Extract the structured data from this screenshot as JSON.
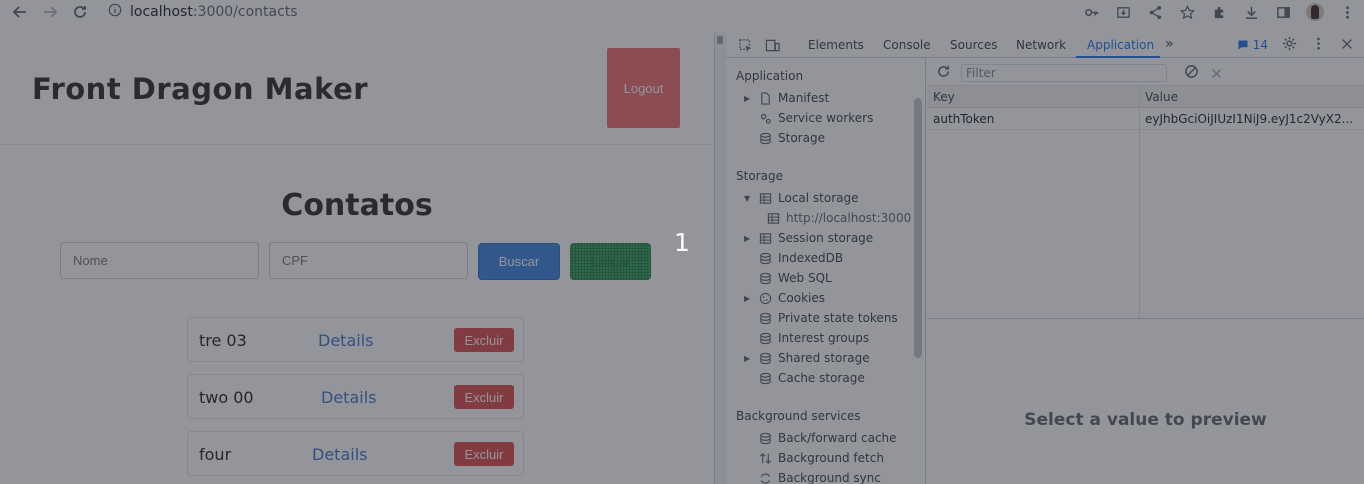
{
  "browser": {
    "url_host": "localhost",
    "url_path": ":3000/contacts"
  },
  "page": {
    "brand": "Front Dragon Maker",
    "logout_label": "Logout",
    "title": "Contatos",
    "search": {
      "name_placeholder": "Nome",
      "cpf_placeholder": "CPF",
      "buscar_label": "Buscar",
      "limpar_label": "Limpar"
    },
    "step_marker": "1",
    "contacts": [
      {
        "name": "tre 03",
        "details": "Details",
        "delete": "Excluir"
      },
      {
        "name": "two 00",
        "details": "Details",
        "delete": "Excluir"
      },
      {
        "name": "four",
        "details": "Details",
        "delete": "Excluir"
      }
    ]
  },
  "devtools": {
    "tabs": [
      "Elements",
      "Console",
      "Sources",
      "Network",
      "Application"
    ],
    "active_tab": "Application",
    "message_count": "14",
    "sidebar": {
      "application_heading": "Application",
      "application_items": [
        "Manifest",
        "Service workers",
        "Storage"
      ],
      "storage_heading": "Storage",
      "storage_items": [
        "Local storage",
        "http://localhost:3000",
        "Session storage",
        "IndexedDB",
        "Web SQL",
        "Cookies",
        "Private state tokens",
        "Interest groups",
        "Shared storage",
        "Cache storage"
      ],
      "background_heading": "Background services",
      "background_items": [
        "Back/forward cache",
        "Background fetch",
        "Background sync"
      ]
    },
    "storage_table": {
      "filter_placeholder": "Filter",
      "key_header": "Key",
      "value_header": "Value",
      "row_key": "authToken",
      "row_value": "eyJhbGciOiJIUzI1NiJ9.eyJ1c2VyX2..."
    },
    "preview_text": "Select a value to preview"
  },
  "colors": {
    "logout": "#ee6d6d",
    "buscar": "#3d82dd",
    "limpar": "#32a55a",
    "excluir": "#dc4b4b",
    "details_link": "#3b74c8",
    "devtools_accent": "#1a73e8"
  }
}
